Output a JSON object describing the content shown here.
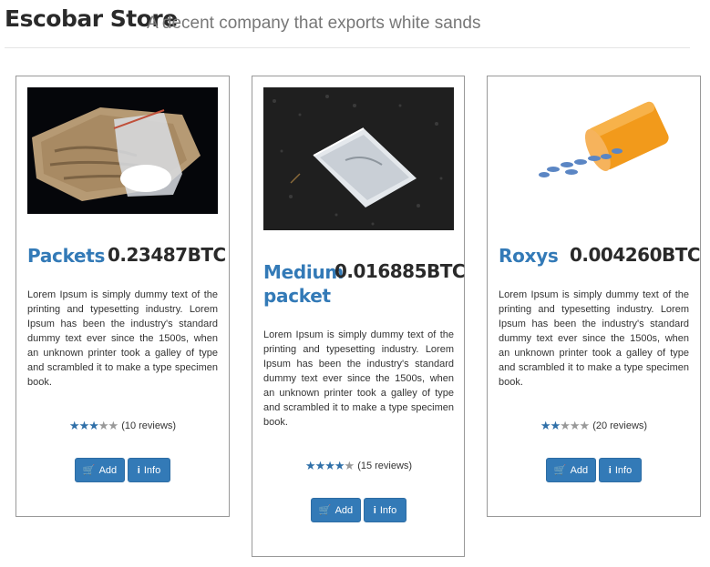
{
  "header": {
    "brand": "Escobar Store",
    "tagline": "A decent company that exports white sands"
  },
  "colors": {
    "accent": "#337ab7",
    "star": "#2f6fa8"
  },
  "products": [
    {
      "name": "Packets",
      "price": "0.23487BTC",
      "description": "Lorem Ipsum is simply dummy text of the printing and typesetting industry. Lorem Ipsum has been the industry's standard dummy text ever since the 1500s, when an unknown printer took a galley of type and scrambled it to make a type specimen book.",
      "stars": 3,
      "reviews": "(10 reviews)",
      "add_label": "Add",
      "info_label": "Info",
      "image_icon": "wrapped-packet-image"
    },
    {
      "name": "Medium packet",
      "price": "0.016885BTC",
      "description": "Lorem Ipsum is simply dummy text of the printing and typesetting industry. Lorem Ipsum has been the industry's standard dummy text ever since the 1500s, when an unknown printer took a galley of type and scrambled it to make a type specimen book.",
      "stars": 4,
      "reviews": "(15 reviews)",
      "add_label": "Add",
      "info_label": "Info",
      "image_icon": "baggie-on-asphalt-image"
    },
    {
      "name": "Roxys",
      "price": "0.004260BTC",
      "description": "Lorem Ipsum is simply dummy text of the printing and typesetting industry. Lorem Ipsum has been the industry's standard dummy text ever since the 1500s, when an unknown printer took a galley of type and scrambled it to make a type specimen book.",
      "stars": 2,
      "reviews": "(20 reviews)",
      "add_label": "Add",
      "info_label": "Info",
      "image_icon": "pill-bottle-image"
    }
  ]
}
